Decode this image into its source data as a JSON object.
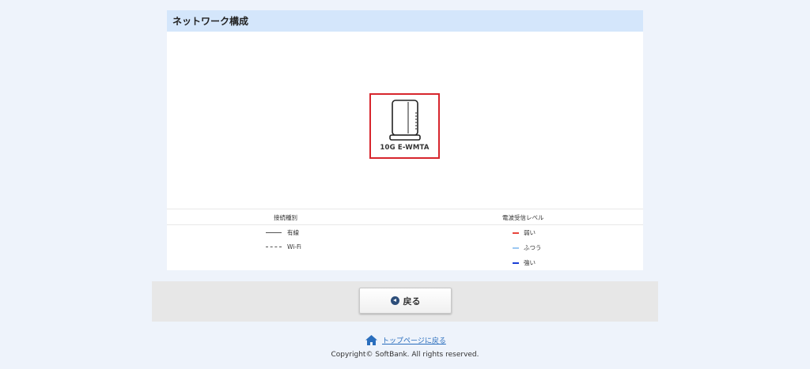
{
  "card": {
    "title": "ネットワーク構成"
  },
  "device": {
    "name": "10G E-WMTA"
  },
  "legend": {
    "connection_type_header": "接続種別",
    "signal_level_header": "電波受信レベル",
    "connection_types": [
      {
        "label": "有線",
        "style": "solid"
      },
      {
        "label": "Wi-Fi",
        "style": "dashed"
      }
    ],
    "signal_levels": [
      {
        "label": "弱い",
        "color": "#e8453c"
      },
      {
        "label": "ふつう",
        "color": "#9cc8f2"
      },
      {
        "label": "強い",
        "color": "#1a3fd6"
      }
    ]
  },
  "footer": {
    "back_label": "戻る",
    "top_link": "トップページに戻る",
    "copyright": "Copyright© SoftBank. All rights reserved."
  },
  "colors": {
    "page_bg": "#eef3fb",
    "header_bg": "#d4e6fb",
    "highlight_border": "#d7262d",
    "link": "#2a6ebd"
  }
}
